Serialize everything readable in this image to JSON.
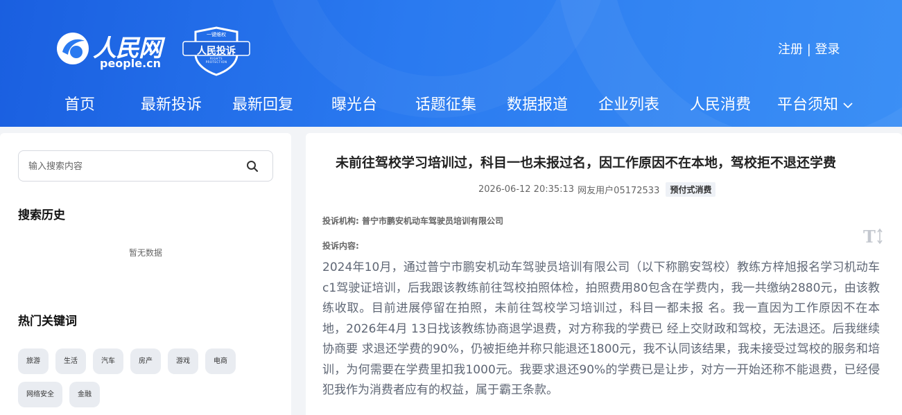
{
  "header": {
    "logo": {
      "cn": "人民网",
      "en": "people.cn"
    },
    "badge": {
      "top": "一键维权",
      "main": "人民投诉",
      "sub": "RIGHTS PROTECTION"
    },
    "auth": {
      "register": "注册",
      "separator": " | ",
      "login": "登录"
    },
    "nav": [
      "首页",
      "最新投诉",
      "最新回复",
      "曝光台",
      "话题征集",
      "数据报道",
      "企业列表",
      "人民消费",
      "平台须知"
    ]
  },
  "sidebar": {
    "search": {
      "placeholder": "输入搜索内容"
    },
    "history": {
      "title": "搜索历史",
      "empty_text": "暂无数据"
    },
    "hot": {
      "title": "热门关键词",
      "tags": [
        "旅游",
        "生活",
        "汽车",
        "房产",
        "游戏",
        "电商",
        "网络安全",
        "金融"
      ]
    }
  },
  "article": {
    "title": "未前往驾校学习培训过，科目一也未报过名，因工作原因不在本地，驾校拒不退还学费",
    "date": "2026-06-12 20:35:13",
    "user": "网友用户05172533",
    "category": "预付式消费",
    "org_label": "投诉机构:",
    "org_name": "普宁市鹏安机动车驾驶员培训有限公司",
    "content_label": "投诉内容:",
    "content": "2024年10月，通过普宁市鹏安机动车驾驶员培训有限公司（以下称鹏安驾校）教练方梓旭报名学习机动车c1驾驶证培训，后我跟该教练前往驾校拍照体检，拍照费用80包含在学费内，我一共缴纳2880元，由该教练收取。目前进展停留在拍照，未前往驾校学习培训过，科目一都未报 名。我一直因为工作原因不在本地，2026年4月 13日找该教练协商退学退费，对方称我的学费已 经上交财政和驾校，无法退还。后我继续协商要 求退还学费的90%，仍被拒绝并称只能退还1800元，我不认同该结果，我未接受过驾校的服务和培训，为何需要在学费里扣我1000元。我要求退还90%的学费已是让步，对方一开始还称不能退费，已经侵犯我作为消费者应有的权益，属于霸王条款。"
  },
  "icons": {
    "search": "search-icon",
    "dropdown": "chevron-down-icon",
    "font_size": "font-size-icon",
    "logo_mark": "people-logo-icon",
    "shield": "shield-badge-icon"
  },
  "colors": {
    "header_blue": "#2a7af0",
    "tag_bg": "#e9ecf1",
    "text_gray": "#5f6775"
  }
}
